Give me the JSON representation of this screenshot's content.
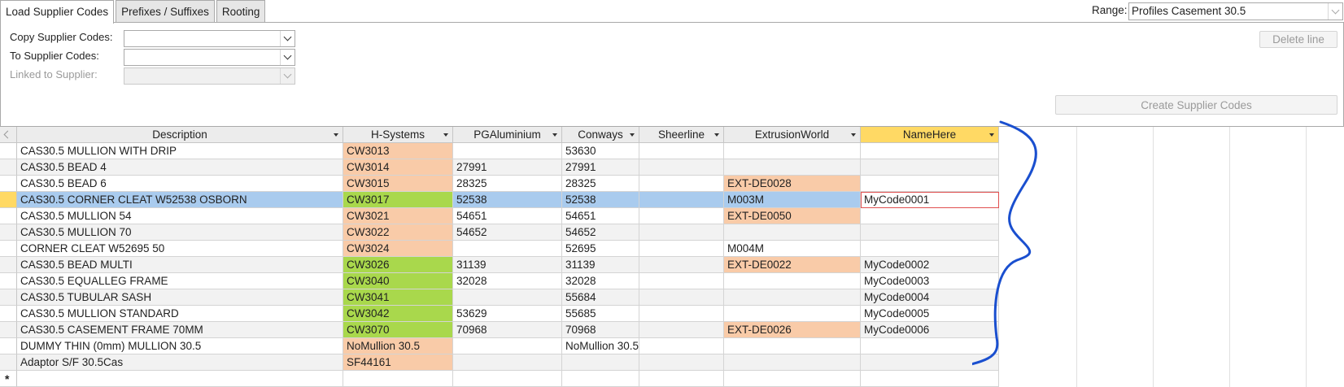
{
  "tabs": [
    {
      "label": "Load Supplier Codes",
      "active": true
    },
    {
      "label": "Prefixes / Suffixes",
      "active": false
    },
    {
      "label": "Rooting",
      "active": false
    }
  ],
  "range": {
    "label": "Range:",
    "value": "Profiles Casement 30.5"
  },
  "form": {
    "copy_label": "Copy Supplier Codes:",
    "to_label": "To Supplier Codes:",
    "linked_label": "Linked to Supplier:",
    "copy_value": "",
    "to_value": "",
    "linked_value": ""
  },
  "buttons": {
    "delete_line": "Delete line",
    "create_codes": "Create Supplier Codes"
  },
  "grid": {
    "columns": [
      "Description",
      "H-Systems",
      "PGAluminium",
      "Conways",
      "Sheerline",
      "ExtrusionWorld",
      "NameHere"
    ],
    "new_row_marker": "*",
    "rows": [
      {
        "desc": "CAS30.5 MULLION WITH DRIP",
        "hsys": "CW3013",
        "pg": "",
        "conw": "53630",
        "sheer": "",
        "ext": "",
        "name": "",
        "hcolor": "orange",
        "ecolor": ""
      },
      {
        "desc": "CAS30.5 BEAD 4",
        "hsys": "CW3014",
        "pg": "27991",
        "conw": "27991",
        "sheer": "",
        "ext": "",
        "name": "",
        "hcolor": "orange",
        "ecolor": ""
      },
      {
        "desc": "CAS30.5 BEAD 6",
        "hsys": "CW3015",
        "pg": "28325",
        "conw": "28325",
        "sheer": "",
        "ext": "EXT-DE0028",
        "name": "",
        "hcolor": "orange",
        "ecolor": "orange"
      },
      {
        "desc": "CAS30.5 CORNER CLEAT W52538 OSBORN",
        "hsys": "CW3017",
        "pg": "52538",
        "conw": "52538",
        "sheer": "",
        "ext": "M003M",
        "name": "MyCode0001",
        "hcolor": "green",
        "ecolor": "",
        "current": true
      },
      {
        "desc": "CAS30.5 MULLION 54",
        "hsys": "CW3021",
        "pg": "54651",
        "conw": "54651",
        "sheer": "",
        "ext": "EXT-DE0050",
        "name": "",
        "hcolor": "orange",
        "ecolor": "orange"
      },
      {
        "desc": "CAS30.5 MULLION 70",
        "hsys": "CW3022",
        "pg": "54652",
        "conw": "54652",
        "sheer": "",
        "ext": "",
        "name": "",
        "hcolor": "orange",
        "ecolor": ""
      },
      {
        "desc": "CORNER CLEAT W52695 50",
        "hsys": "CW3024",
        "pg": "",
        "conw": "52695",
        "sheer": "",
        "ext": "M004M",
        "name": "",
        "hcolor": "orange",
        "ecolor": ""
      },
      {
        "desc": "CAS30.5 BEAD MULTI",
        "hsys": "CW3026",
        "pg": "31139",
        "conw": "31139",
        "sheer": "",
        "ext": "EXT-DE0022",
        "name": "MyCode0002",
        "hcolor": "green",
        "ecolor": "orange"
      },
      {
        "desc": "CAS30.5 EQUALLEG FRAME",
        "hsys": "CW3040",
        "pg": "32028",
        "conw": "32028",
        "sheer": "",
        "ext": "",
        "name": "MyCode0003",
        "hcolor": "green",
        "ecolor": ""
      },
      {
        "desc": "CAS30.5 TUBULAR SASH",
        "hsys": "CW3041",
        "pg": "",
        "conw": "55684",
        "sheer": "",
        "ext": "",
        "name": "MyCode0004",
        "hcolor": "green",
        "ecolor": ""
      },
      {
        "desc": "CAS30.5 MULLION STANDARD",
        "hsys": "CW3042",
        "pg": "53629",
        "conw": "55685",
        "sheer": "",
        "ext": "",
        "name": "MyCode0005",
        "hcolor": "green",
        "ecolor": ""
      },
      {
        "desc": "CAS30.5 CASEMENT FRAME 70MM",
        "hsys": "CW3070",
        "pg": "70968",
        "conw": "70968",
        "sheer": "",
        "ext": "EXT-DE0026",
        "name": "MyCode0006",
        "hcolor": "green",
        "ecolor": "orange"
      },
      {
        "desc": "DUMMY THIN (0mm) MULLION 30.5",
        "hsys": "NoMullion 30.5",
        "pg": "",
        "conw": "NoMullion 30.5",
        "sheer": "",
        "ext": "",
        "name": "",
        "hcolor": "orange",
        "ecolor": ""
      },
      {
        "desc": "Adaptor S/F 30.5Cas",
        "hsys": "SF44161",
        "pg": "",
        "conw": "",
        "sheer": "",
        "ext": "",
        "name": "",
        "hcolor": "orange",
        "ecolor": ""
      }
    ]
  },
  "colors": {
    "orange": "#f9cba8",
    "green": "#a9d84c",
    "selected_row": "#a9cbee",
    "record_selector": "#ffd964",
    "annotation_brace": "#1a4fcf"
  }
}
